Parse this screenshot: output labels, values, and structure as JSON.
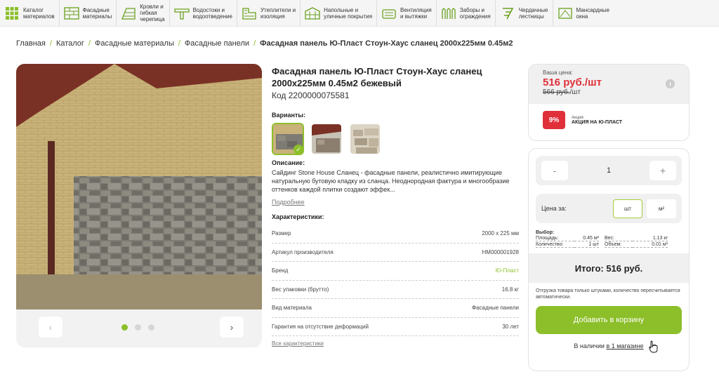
{
  "nav": [
    {
      "label": "Каталог\nматериалов",
      "icon": "grid-icon"
    },
    {
      "label": "Фасадные\nматериалы",
      "icon": "facade-icon"
    },
    {
      "label": "Кровли и\nгибкая\nчерепица",
      "icon": "roof-icon"
    },
    {
      "label": "Водостоки и\nводоотведение",
      "icon": "gutter-icon"
    },
    {
      "label": "Утеплители и\nизоляция",
      "icon": "insulation-icon"
    },
    {
      "label": "Напольные и\nуличные покрытия",
      "icon": "flooring-icon"
    },
    {
      "label": "Вентиляция\nи вытяжки",
      "icon": "ventilation-icon"
    },
    {
      "label": "Заборы и\nограждения",
      "icon": "fence-icon"
    },
    {
      "label": "Чердачные\nлестницы",
      "icon": "ladder-icon"
    },
    {
      "label": "Мансардные\nокна",
      "icon": "window-icon"
    }
  ],
  "breadcrumb": {
    "items": [
      "Главная",
      "Каталог",
      "Фасадные материалы",
      "Фасадные панели"
    ],
    "separator": "/",
    "current": "Фасадная панель Ю-Пласт Стоун-Хаус сланец 2000х225мм 0.45м2"
  },
  "product": {
    "title": "Фасадная панель Ю-Пласт Стоун-Хаус сланец 2000х225мм 0.45м2 бежевый",
    "code": "Код 2200000075581",
    "variants_label": "Варианты:",
    "description_label": "Описание:",
    "description": "Сайдинг Stone House Сланец - фасадные панели, реалистично имитирующие натуральную бутовую кладку из сланца. Неоднородная фактура и многообразие оттенков каждой плитки создают эффек...",
    "more_link": "Подробнее",
    "characteristics_label": "Характеристики:",
    "characteristics": [
      {
        "name": "Размер",
        "value": "2000 x 225 мм"
      },
      {
        "name": "Артикул производителя",
        "value": "HM000001928"
      },
      {
        "name": "Бренд",
        "value": "Ю-Пласт"
      },
      {
        "name": "Вес упаковки (брутто)",
        "value": "16.8 кг"
      },
      {
        "name": "Вид материала",
        "value": "Фасадные панели"
      },
      {
        "name": "Гарантия на отсутствие деформаций",
        "value": "30 лет"
      }
    ],
    "all_characteristics_link": "Все характеристики"
  },
  "gallery": {
    "prev_icon": "‹",
    "next_icon": "›",
    "dots": 3,
    "active_dot": 0
  },
  "price": {
    "your_price_label": "Ваша цена:",
    "current": "516 руб./шт",
    "old_value": "566 руб.",
    "old_unit": "/шт",
    "info_icon": "i",
    "promo_badge": "9%",
    "promo_label": "Акция:",
    "promo_name": "АКЦИЯ НА Ю-ПЛАСТ"
  },
  "order": {
    "minus": "-",
    "quantity": "1",
    "plus": "+",
    "price_per_label": "Цена за:",
    "unit_pcs": "шт",
    "unit_m2": "м²",
    "choice_label": "Выбор:",
    "area_label": "Площадь:",
    "area_value": "0.45 м²",
    "weight_label": "Вес:",
    "weight_value": "1.13 кг",
    "count_label": "Количество:",
    "count_value": "1 шт",
    "volume_label": "Объем:",
    "volume_value": "0.01 м³",
    "total": "Итого: 516 руб.",
    "note": "Отгрузка товара только штуками, количество пересчитывается автоматически.",
    "add_button": "Добавить в корзину",
    "stock_prefix": "В наличии",
    "stock_link": "в 1 магазине"
  },
  "colors": {
    "accent": "#8cbf2a",
    "price_red": "#e0303a"
  }
}
